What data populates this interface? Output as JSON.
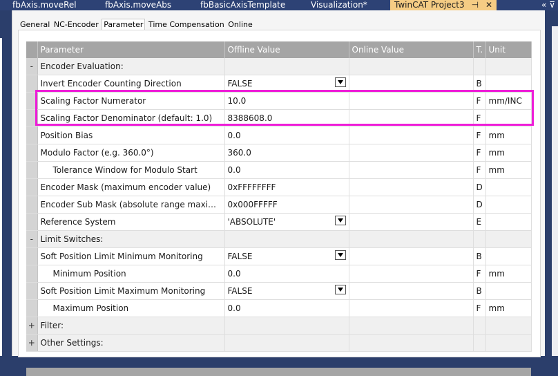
{
  "doc_tabs": [
    {
      "label": "fbAxis.moveRel"
    },
    {
      "label": "fbAxis.moveAbs"
    },
    {
      "label": "fbBasicAxisTemplate"
    },
    {
      "label": "Visualization*"
    },
    {
      "label": "TwinCAT Project3"
    }
  ],
  "doc_tab_icons": {
    "pin": "⊣",
    "close": "✕",
    "overflow": "«  ⊽"
  },
  "sub_tabs": [
    {
      "label": "General"
    },
    {
      "label": "NC-Encoder"
    },
    {
      "label": "Parameter"
    },
    {
      "label": "Time Compensation"
    },
    {
      "label": "Online"
    }
  ],
  "columns": {
    "expand": "",
    "parameter": "Parameter",
    "offline": "Offline Value",
    "online": "Online Value",
    "type": "T.",
    "unit": "Unit"
  },
  "rows": [
    {
      "exp": "-",
      "param": "Encoder Evaluation:",
      "offline": "",
      "online": "",
      "type": "",
      "unit": ""
    },
    {
      "exp": "",
      "param": "Invert Encoder Counting Direction",
      "offline": "FALSE",
      "online": "",
      "type": "B",
      "unit": ""
    },
    {
      "exp": "",
      "param": "Scaling Factor Numerator",
      "offline": "10.0",
      "online": "",
      "type": "F",
      "unit": "mm/INC"
    },
    {
      "exp": "",
      "param": "Scaling Factor Denominator (default: 1.0)",
      "offline": "8388608.0",
      "online": "",
      "type": "F",
      "unit": ""
    },
    {
      "exp": "",
      "param": "Position Bias",
      "offline": "0.0",
      "online": "",
      "type": "F",
      "unit": "mm"
    },
    {
      "exp": "",
      "param": "Modulo Factor (e.g. 360.0°)",
      "offline": "360.0",
      "online": "",
      "type": "F",
      "unit": "mm"
    },
    {
      "exp": "",
      "param": "Tolerance Window for Modulo Start",
      "offline": "0.0",
      "online": "",
      "type": "F",
      "unit": "mm"
    },
    {
      "exp": "",
      "param": "Encoder Mask (maximum encoder value)",
      "offline": "0xFFFFFFFF",
      "online": "",
      "type": "D",
      "unit": ""
    },
    {
      "exp": "",
      "param": "Encoder Sub Mask (absolute range maximum va...",
      "offline": "0x000FFFFF",
      "online": "",
      "type": "D",
      "unit": ""
    },
    {
      "exp": "",
      "param": "Reference System",
      "offline": "'ABSOLUTE'",
      "online": "",
      "type": "E",
      "unit": ""
    },
    {
      "exp": "-",
      "param": "Limit Switches:",
      "offline": "",
      "online": "",
      "type": "",
      "unit": ""
    },
    {
      "exp": "",
      "param": "Soft Position Limit Minimum Monitoring",
      "offline": "FALSE",
      "online": "",
      "type": "B",
      "unit": ""
    },
    {
      "exp": "",
      "param": "Minimum Position",
      "offline": "0.0",
      "online": "",
      "type": "F",
      "unit": "mm"
    },
    {
      "exp": "",
      "param": "Soft Position Limit Maximum Monitoring",
      "offline": "FALSE",
      "online": "",
      "type": "B",
      "unit": ""
    },
    {
      "exp": "",
      "param": "Maximum Position",
      "offline": "0.0",
      "online": "",
      "type": "F",
      "unit": "mm"
    },
    {
      "exp": "+",
      "param": "Filter:",
      "offline": "",
      "online": "",
      "type": "",
      "unit": ""
    },
    {
      "exp": "+",
      "param": "Other Settings:",
      "offline": "",
      "online": "",
      "type": "",
      "unit": ""
    }
  ],
  "highlight_color": "#ee1dd8",
  "active_tab_color": "#f5cc84"
}
